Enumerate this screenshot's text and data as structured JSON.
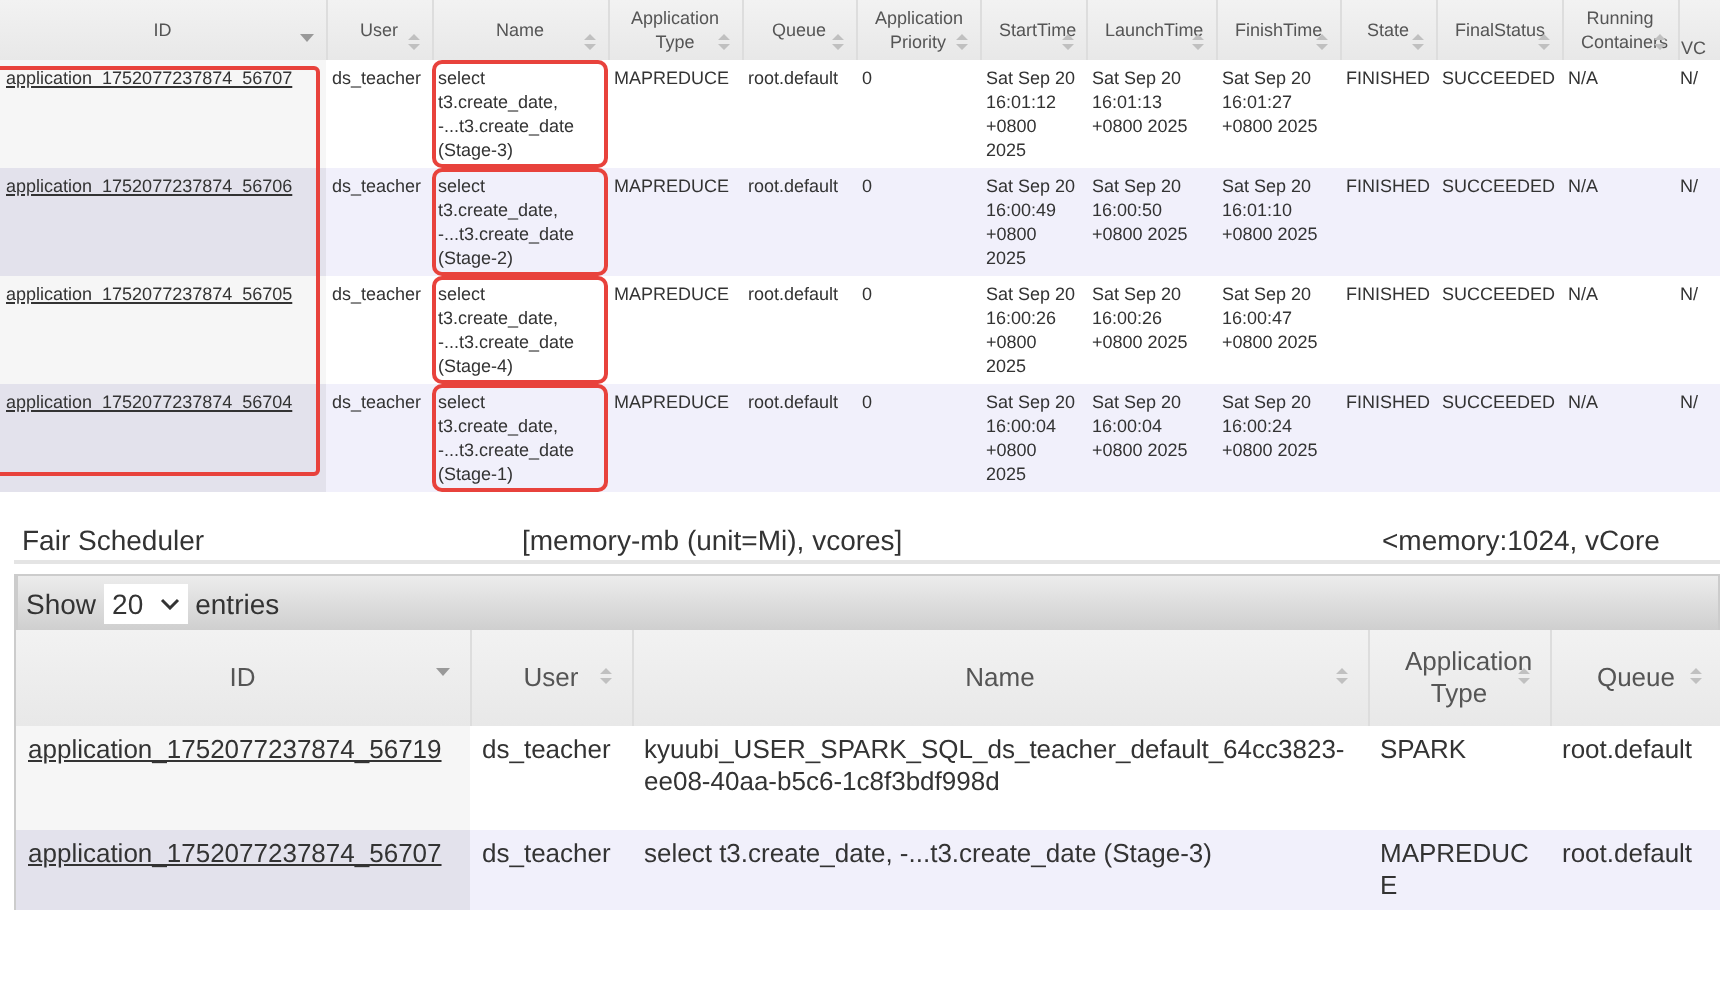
{
  "top_table": {
    "id_column_framed": true,
    "columns": [
      {
        "label": "ID",
        "sorted": true
      },
      {
        "label": "User",
        "sorted": false
      },
      {
        "label": "Name",
        "sorted": false
      },
      {
        "label": "Application Type",
        "sorted": false
      },
      {
        "label": "Queue",
        "sorted": false
      },
      {
        "label": "Application Priority",
        "sorted": false
      },
      {
        "label": "StartTime",
        "sorted": false
      },
      {
        "label": "LaunchTime",
        "sorted": false
      },
      {
        "label": "FinishTime",
        "sorted": false
      },
      {
        "label": "State",
        "sorted": false
      },
      {
        "label": "FinalStatus",
        "sorted": false
      },
      {
        "label": "Running Containers",
        "sorted": false
      },
      {
        "label": "VC"
      }
    ],
    "rows": [
      {
        "name_framed": true,
        "cells": [
          "application_1752077237874_56707",
          "ds_teacher",
          "select t3.create_date, -...t3.create_date (Stage-3)",
          "MAPREDUCE",
          "root.default",
          "0",
          "Sat Sep 20 16:01:12 +0800 2025",
          "Sat Sep 20 16:01:13 +0800 2025",
          "Sat Sep 20 16:01:27 +0800 2025",
          "FINISHED",
          "SUCCEEDED",
          "N/A",
          "N/"
        ]
      },
      {
        "name_framed": true,
        "cells": [
          "application_1752077237874_56706",
          "ds_teacher",
          "select t3.create_date, -...t3.create_date (Stage-2)",
          "MAPREDUCE",
          "root.default",
          "0",
          "Sat Sep 20 16:00:49 +0800 2025",
          "Sat Sep 20 16:00:50 +0800 2025",
          "Sat Sep 20 16:01:10 +0800 2025",
          "FINISHED",
          "SUCCEEDED",
          "N/A",
          "N/"
        ]
      },
      {
        "name_framed": true,
        "cells": [
          "application_1752077237874_56705",
          "ds_teacher",
          "select t3.create_date, -...t3.create_date (Stage-4)",
          "MAPREDUCE",
          "root.default",
          "0",
          "Sat Sep 20 16:00:26 +0800 2025",
          "Sat Sep 20 16:00:26 +0800 2025",
          "Sat Sep 20 16:00:47 +0800 2025",
          "FINISHED",
          "SUCCEEDED",
          "N/A",
          "N/"
        ]
      },
      {
        "name_framed": true,
        "cells": [
          "application_1752077237874_56704",
          "ds_teacher",
          "select t3.create_date, -...t3.create_date (Stage-1)",
          "MAPREDUCE",
          "root.default",
          "0",
          "Sat Sep 20 16:00:04 +0800 2025",
          "Sat Sep 20 16:00:04 +0800 2025",
          "Sat Sep 20 16:00:24 +0800 2025",
          "FINISHED",
          "SUCCEEDED",
          "N/A",
          "N/"
        ]
      }
    ]
  },
  "scheduler": {
    "type": "Fair Scheduler",
    "resource_types": "[memory-mb (unit=Mi), vcores]",
    "minimum_allocation": "<memory:1024, vCore"
  },
  "entries": {
    "show_label": "Show",
    "page_size": "20",
    "entries_label": "entries"
  },
  "bottom_table": {
    "columns": [
      {
        "label": "ID",
        "sorted": true
      },
      {
        "label": "User",
        "sorted": false
      },
      {
        "label": "Name",
        "sorted": false
      },
      {
        "label": "Application Type",
        "sorted": false
      },
      {
        "label": "Queue",
        "sorted": false
      }
    ],
    "rows": [
      {
        "cells": [
          "application_1752077237874_56719",
          "ds_teacher",
          "kyuubi_USER_SPARK_SQL_ds_teacher_default_64cc3823-ee08-40aa-b5c6-1c8f3bdf998d",
          "SPARK",
          "root.default"
        ]
      },
      {
        "cells": [
          "application_1752077237874_56707",
          "ds_teacher",
          "select t3.create_date, -...t3.create_date (Stage-3)",
          "MAPREDUCE",
          "root.default"
        ]
      }
    ]
  }
}
